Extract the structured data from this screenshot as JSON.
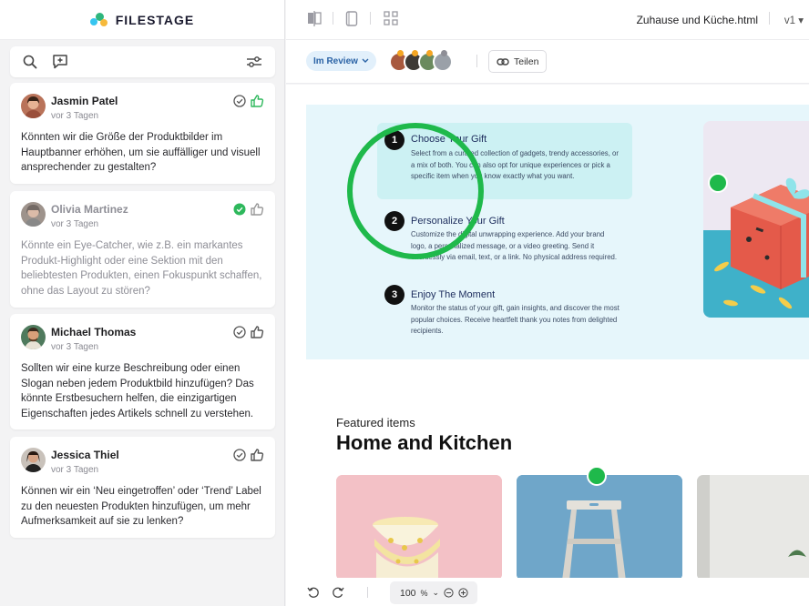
{
  "brand": {
    "name": "FILESTAGE"
  },
  "toolbar": {
    "search_icon": "search-icon",
    "comment_icon": "add-comment-icon",
    "filter_icon": "filter-icon"
  },
  "comments": [
    {
      "name": "Jasmin Patel",
      "time": "vor 3 Tagen",
      "text": "Könnten wir die Größe der Produktbilder im Hauptbanner erhöhen, um sie auffälliger und visuell ansprechender zu gestalten?",
      "resolved": false,
      "liked": true
    },
    {
      "name": "Olivia Martinez",
      "time": "vor 3 Tagen",
      "text": "Könnte ein Eye-Catcher, wie z.B. ein markantes Produkt-Highlight oder eine Sektion mit den beliebtesten Produkten, einen Fokuspunkt schaffen, ohne das Layout zu stören?",
      "resolved": true,
      "liked": false
    },
    {
      "name": "Michael Thomas",
      "time": "vor 3 Tagen",
      "text": "Sollten wir eine kurze Beschreibung oder einen Slogan neben jedem Produktbild hinzufügen? Das könnte Erstbesuchern helfen, die einzigartigen Eigenschaften jedes Artikels schnell zu verstehen.",
      "resolved": false,
      "liked": false
    },
    {
      "name": "Jessica Thiel",
      "time": "vor 3 Tagen",
      "text": "Können wir ein ‘Neu eingetroffen’ oder ‘Trend’ Label zu den neuesten Produkten hinzufügen, um mehr Aufmerksamkeit auf sie zu lenken?",
      "resolved": false,
      "liked": false
    }
  ],
  "header": {
    "file_name": "Zuhause und Küche.html",
    "version": "v1"
  },
  "review": {
    "status": "Im Review",
    "share_label": "Teilen"
  },
  "steps": [
    {
      "num": "1",
      "title": "Choose Your Gift",
      "desc": "Select from a curated collection of gadgets, trendy accessories, or a mix of both. You can also opt for unique experiences or pick a specific item when you know exactly what you want."
    },
    {
      "num": "2",
      "title": "Personalize Your Gift",
      "desc": "Customize the digital unwrapping experience. Add your brand logo, a personalized message, or a video greeting. Send it effortlessly via email, text, or a link. No physical address required."
    },
    {
      "num": "3",
      "title": "Enjoy The Moment",
      "desc": "Monitor the status of your gift, gain insights, and discover the most popular choices. Receive heartfelt thank you notes from delighted recipients."
    }
  ],
  "featured": {
    "subtitle": "Featured items",
    "title": "Home and Kitchen"
  },
  "zoom": {
    "level": "100",
    "unit": "%"
  },
  "colors": {
    "accent_green": "#1fb94b",
    "status_blue": "#2b63a6",
    "like_green": "#2eb85c"
  }
}
